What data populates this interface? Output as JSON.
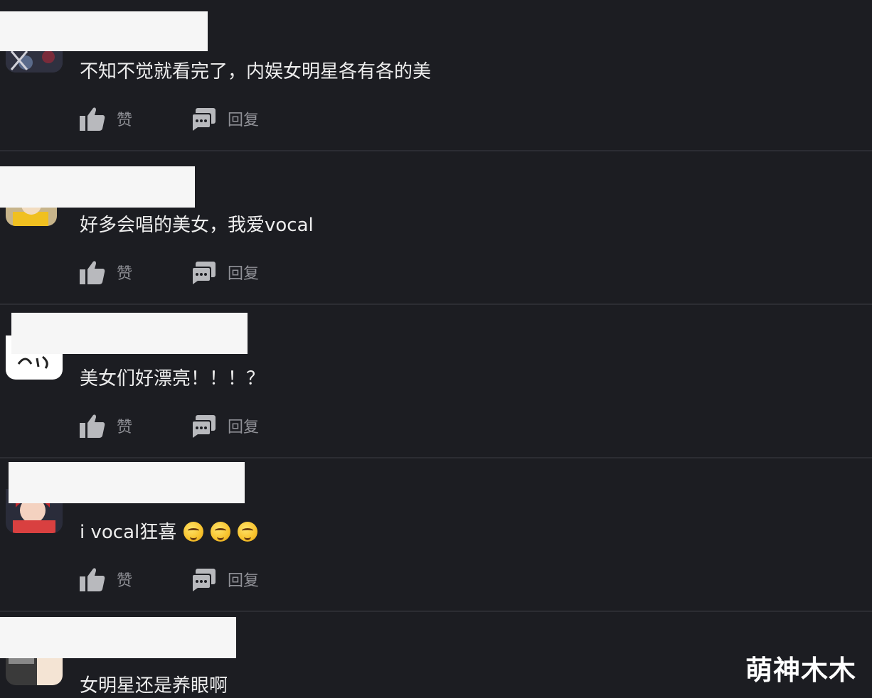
{
  "comments": [
    {
      "text": "不知不觉就看完了，内娱女明星各有各的美",
      "like_label": "赞",
      "reply_label": "回复"
    },
    {
      "text": "好多会唱的美女，我爱vocal",
      "like_label": "赞",
      "reply_label": "回复"
    },
    {
      "text": "美女们好漂亮！！！？",
      "like_label": "赞",
      "reply_label": "回复"
    },
    {
      "text": "i vocal狂喜",
      "emojis": [
        "drooling-face-emoji",
        "drooling-face-emoji",
        "smirking-face-emoji"
      ],
      "like_label": "赞",
      "reply_label": "回复"
    },
    {
      "text": "女明星还是养眼啊"
    }
  ],
  "watermark": "萌神木木",
  "colors": {
    "background": "#1c1d22",
    "divider": "#2c2d33",
    "text": "#eeeeee",
    "action_text": "#8f9096",
    "icon": "#b8b9bd",
    "name_mask": "#f6f6f6"
  }
}
